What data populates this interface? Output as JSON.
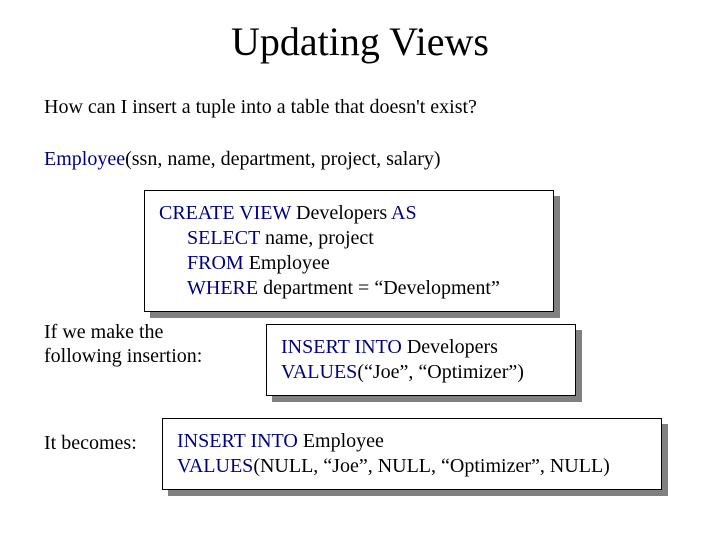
{
  "title": "Updating Views",
  "intro": "How can I insert a tuple into a table that doesn't exist?",
  "schema": {
    "relation": "Employee",
    "attrs": "(ssn, name, department, project, salary)"
  },
  "box1": {
    "l1a": "CREATE VIEW",
    "l1b": "  Developers ",
    "l1c": "AS",
    "l2a": "SELECT",
    "l2b": " name, project",
    "l3a": "FROM",
    "l3b": "  Employee",
    "l4a": "WHERE",
    "l4b": " department = “Development”"
  },
  "label_if": "If we make the following insertion:",
  "box2": {
    "l1a": "INSERT INTO",
    "l1b": "  Developers",
    "l2a": "VALUES",
    "l2b": "(“Joe”, “Optimizer”)"
  },
  "label_becomes": "It becomes:",
  "box3": {
    "l1a": "INSERT INTO",
    "l1b": "  Employee",
    "l2a": "VALUES",
    "l2b": "(NULL, “Joe”, NULL, “Optimizer”, NULL)"
  }
}
